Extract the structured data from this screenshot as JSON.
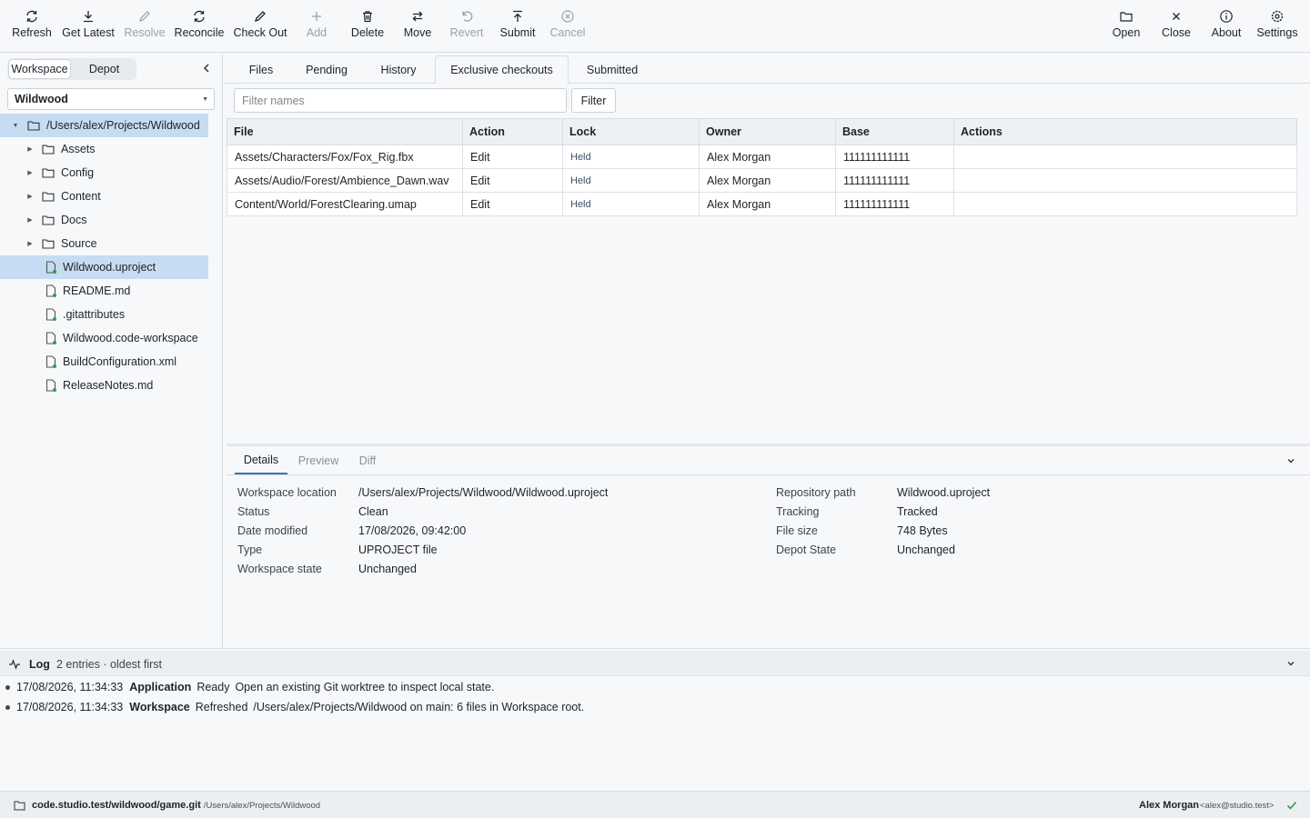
{
  "toolbar": {
    "left": [
      {
        "label": "Refresh",
        "icon": "refresh-icon",
        "disabled": false
      },
      {
        "label": "Get Latest",
        "icon": "download-icon",
        "disabled": false
      },
      {
        "label": "Resolve",
        "icon": "pencil-icon",
        "disabled": true
      },
      {
        "label": "Reconcile",
        "icon": "sync-icon",
        "disabled": false
      },
      {
        "label": "Check Out",
        "icon": "pen-icon",
        "disabled": false
      },
      {
        "label": "Add",
        "icon": "plus-icon",
        "disabled": true
      },
      {
        "label": "Delete",
        "icon": "trash-icon",
        "disabled": false
      },
      {
        "label": "Move",
        "icon": "arrows-icon",
        "disabled": false
      },
      {
        "label": "Revert",
        "icon": "undo-icon",
        "disabled": true
      },
      {
        "label": "Submit",
        "icon": "upload-icon",
        "disabled": false
      },
      {
        "label": "Cancel",
        "icon": "cancel-circle-icon",
        "disabled": true
      }
    ],
    "right": [
      {
        "label": "Open",
        "icon": "folder-icon"
      },
      {
        "label": "Close",
        "icon": "close-icon"
      },
      {
        "label": "About",
        "icon": "info-icon"
      },
      {
        "label": "Settings",
        "icon": "gear-icon"
      }
    ]
  },
  "sidebar": {
    "segments": [
      "Workspace",
      "Depot"
    ],
    "active_segment": "Workspace",
    "repo_select": "Wildwood",
    "tree": [
      {
        "name": "/Users/alex/Projects/Wildwood",
        "type": "folder",
        "depth": 0,
        "expanded": true
      },
      {
        "name": "Assets",
        "type": "folder",
        "depth": 1
      },
      {
        "name": "Config",
        "type": "folder",
        "depth": 1
      },
      {
        "name": "Content",
        "type": "folder",
        "depth": 1
      },
      {
        "name": "Docs",
        "type": "folder",
        "depth": 1
      },
      {
        "name": "Source",
        "type": "folder",
        "depth": 1
      },
      {
        "name": "Wildwood.uproject",
        "type": "file",
        "depth": 1,
        "selected": true
      },
      {
        "name": "README.md",
        "type": "file",
        "depth": 1
      },
      {
        "name": ".gitattributes",
        "type": "file",
        "depth": 1
      },
      {
        "name": "Wildwood.code-workspace",
        "type": "file",
        "depth": 1
      },
      {
        "name": "BuildConfiguration.xml",
        "type": "file",
        "depth": 1
      },
      {
        "name": "ReleaseNotes.md",
        "type": "file",
        "depth": 1
      }
    ]
  },
  "tabs": {
    "items": [
      "Files",
      "Pending",
      "History",
      "Exclusive checkouts",
      "Submitted"
    ],
    "active": "Exclusive checkouts"
  },
  "filter": {
    "placeholder": "Filter names",
    "value": "",
    "button": "Filter"
  },
  "table": {
    "columns": [
      "File",
      "Action",
      "Lock",
      "Owner",
      "Base",
      "Actions"
    ],
    "rows": [
      {
        "file": "Assets/Characters/Fox/Fox_Rig.fbx",
        "action": "Edit",
        "lock": "Held",
        "owner": "Alex Morgan",
        "base": "111111111111",
        "actions": ""
      },
      {
        "file": "Assets/Audio/Forest/Ambience_Dawn.wav",
        "action": "Edit",
        "lock": "Held",
        "owner": "Alex Morgan",
        "base": "111111111111",
        "actions": ""
      },
      {
        "file": "Content/World/ForestClearing.umap",
        "action": "Edit",
        "lock": "Held",
        "owner": "Alex Morgan",
        "base": "111111111111",
        "actions": ""
      }
    ]
  },
  "details": {
    "tabs": [
      "Details",
      "Preview",
      "Diff"
    ],
    "active": "Details",
    "left": [
      {
        "label": "Workspace location",
        "value": "/Users/alex/Projects/Wildwood/Wildwood.uproject"
      },
      {
        "label": "Status",
        "value": "Clean"
      },
      {
        "label": "Date modified",
        "value": "17/08/2026, 09:42:00"
      },
      {
        "label": "Type",
        "value": "UPROJECT file"
      },
      {
        "label": "Workspace state",
        "value": "Unchanged"
      }
    ],
    "right": [
      {
        "label": "Repository path",
        "value": "Wildwood.uproject"
      },
      {
        "label": "Tracking",
        "value": "Tracked"
      },
      {
        "label": "File size",
        "value": "748 Bytes"
      },
      {
        "label": "Depot State",
        "value": "Unchanged"
      }
    ]
  },
  "log": {
    "title": "Log",
    "subtitle": "2 entries · oldest first",
    "entries": [
      {
        "time": "17/08/2026, 11:34:33",
        "source": "Application",
        "level": "Ready",
        "message": "Open an existing Git worktree to inspect local state."
      },
      {
        "time": "17/08/2026, 11:34:33",
        "source": "Workspace",
        "level": "Refreshed",
        "message": "/Users/alex/Projects/Wildwood on main: 6 files in Workspace root."
      }
    ]
  },
  "status": {
    "repo": "code.studio.test/wildwood/game.git",
    "path": "· /Users/alex/Projects/Wildwood",
    "user": "Alex Morgan",
    "email": "<alex@studio.test>"
  },
  "colors": {
    "accent": "#3b73b9",
    "selection": "#c6dcf2",
    "status_ok": "#2e9e4f",
    "file_badge": "#2e9e4f"
  }
}
